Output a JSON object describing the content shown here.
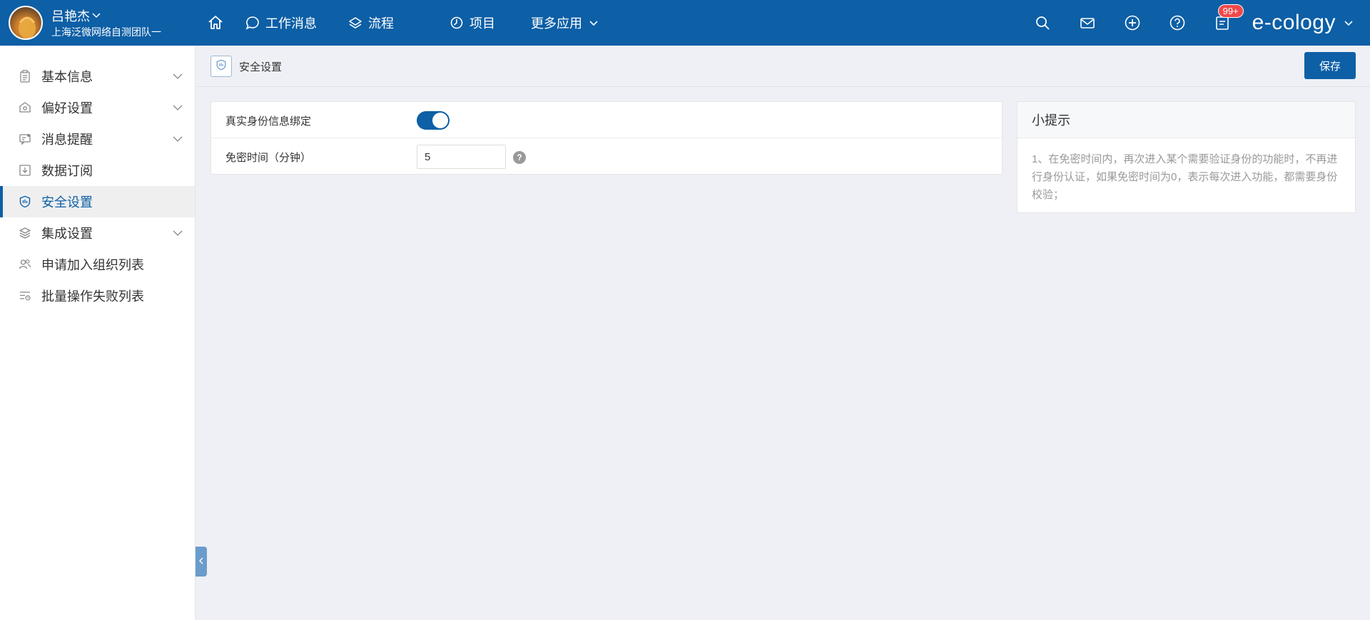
{
  "user": {
    "name": "吕艳杰",
    "org": "上海泛微网络自测团队一"
  },
  "nav": {
    "items": [
      {
        "label": "",
        "icon": "home-icon"
      },
      {
        "label": "工作消息",
        "icon": "chat-icon"
      },
      {
        "label": "流程",
        "icon": "layers-icon"
      },
      {
        "label": "项目",
        "icon": "project-icon"
      },
      {
        "label": "更多应用",
        "icon": "chevron-down-icon"
      }
    ],
    "right_icons": [
      "search-icon",
      "mail-icon",
      "plus-circle-icon",
      "help-circle-icon",
      "notification-icon"
    ],
    "badge": "99+",
    "brand": "e-cology"
  },
  "sidebar": {
    "items": [
      {
        "label": "基本信息",
        "icon": "clipboard-icon",
        "expandable": true,
        "active": false
      },
      {
        "label": "偏好设置",
        "icon": "preference-icon",
        "expandable": true,
        "active": false
      },
      {
        "label": "消息提醒",
        "icon": "message-icon",
        "expandable": true,
        "active": false
      },
      {
        "label": "数据订阅",
        "icon": "subscribe-icon",
        "expandable": false,
        "active": false
      },
      {
        "label": "安全设置",
        "icon": "shield-icon",
        "expandable": false,
        "active": true
      },
      {
        "label": "集成设置",
        "icon": "stack-icon",
        "expandable": true,
        "active": false
      },
      {
        "label": "申请加入组织列表",
        "icon": "users-icon",
        "expandable": false,
        "active": false
      },
      {
        "label": "批量操作失败列表",
        "icon": "list-icon",
        "expandable": false,
        "active": false
      }
    ]
  },
  "page": {
    "title": "安全设置",
    "save_label": "保存"
  },
  "form": {
    "bind_label": "真实身份信息绑定",
    "bind_enabled": true,
    "timeout_label": "免密时间（分钟）",
    "timeout_value": "5",
    "help_glyph": "?"
  },
  "tips": {
    "title": "小提示",
    "body": "1、在免密时间内，再次进入某个需要验证身份的功能时，不再进行身份认证，如果免密时间为0，表示每次进入功能，都需要身份校验；"
  },
  "colors": {
    "primary": "#0d5fa6",
    "badge": "#f0484a",
    "background": "#eff0f5"
  }
}
